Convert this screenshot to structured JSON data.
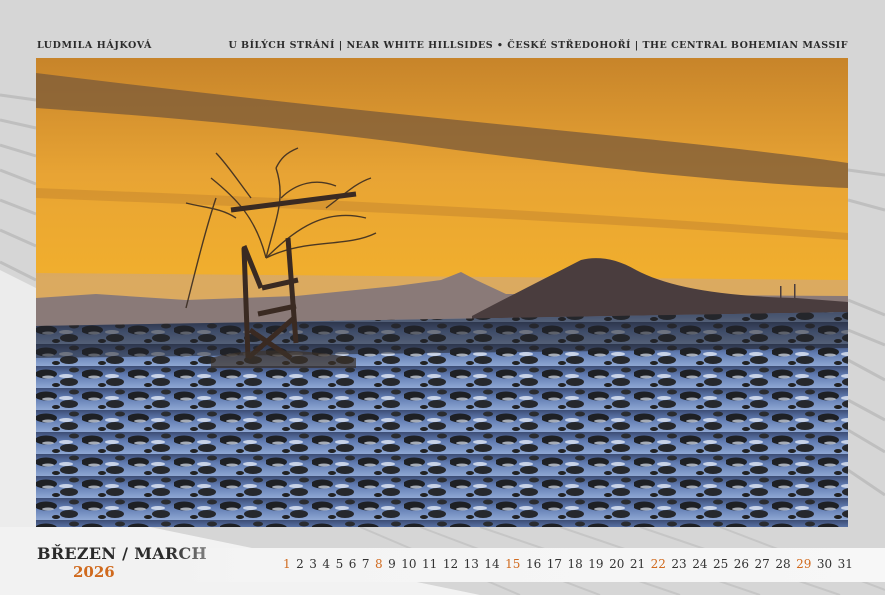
{
  "header": {
    "photographer": "LUDMILA HÁJKOVÁ",
    "caption": "U BÍLÝCH STRÁNÍ | NEAR WHITE HILLSIDES • ČESKÉ STŘEDOHOŘÍ | THE CENTRAL BOHEMIAN MASSIF"
  },
  "month": {
    "name": "BŘEZEN / MARCH",
    "year": "2026"
  },
  "days": [
    {
      "n": "1",
      "sun": true
    },
    {
      "n": "2"
    },
    {
      "n": "3"
    },
    {
      "n": "4"
    },
    {
      "n": "5"
    },
    {
      "n": "6"
    },
    {
      "n": "7"
    },
    {
      "n": "8",
      "sun": true
    },
    {
      "n": "9"
    },
    {
      "n": "10"
    },
    {
      "n": "11"
    },
    {
      "n": "12"
    },
    {
      "n": "13"
    },
    {
      "n": "14"
    },
    {
      "n": "15",
      "sun": true
    },
    {
      "n": "16"
    },
    {
      "n": "17"
    },
    {
      "n": "18"
    },
    {
      "n": "19"
    },
    {
      "n": "20"
    },
    {
      "n": "21"
    },
    {
      "n": "22",
      "sun": true
    },
    {
      "n": "23"
    },
    {
      "n": "24"
    },
    {
      "n": "25"
    },
    {
      "n": "26"
    },
    {
      "n": "27"
    },
    {
      "n": "28"
    },
    {
      "n": "29",
      "sun": true
    },
    {
      "n": "30"
    },
    {
      "n": "31"
    }
  ],
  "colors": {
    "accent": "#d06a1e",
    "text": "#2a2a2a"
  }
}
